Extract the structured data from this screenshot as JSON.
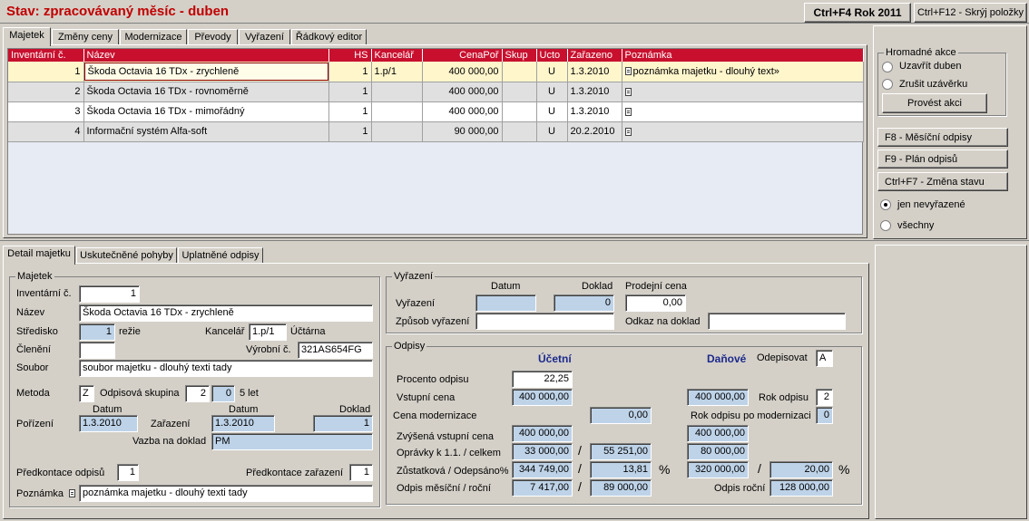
{
  "header": {
    "title": "Stav: zpracovávaný měsíc - duben",
    "btn_year": "Ctrl+F4 Rok 2011",
    "btn_hide": "Ctrl+F12 - Skrýj položky"
  },
  "top_tabs": [
    "Majetek",
    "Změny ceny",
    "Modernizace",
    "Převody",
    "Vyřazení",
    "Řádkový editor"
  ],
  "columns": [
    "Inventární č.",
    "Název",
    "HS",
    "Kancelář",
    "CenaPoř",
    "Skup",
    "Ucto",
    "Zařazeno",
    "Poznámka"
  ],
  "rows": [
    {
      "inv": "1",
      "name": "Škoda Octavia 16 TDx - zrychleně",
      "hs": "1",
      "office": "1.p/1",
      "price": "400 000,00",
      "group": "",
      "ucto": "U",
      "date": "1.3.2010",
      "note": "poznámka majetku - dlouhý text»"
    },
    {
      "inv": "2",
      "name": "Škoda Octavia 16 TDx - rovnoměrně",
      "hs": "1",
      "office": "",
      "price": "400 000,00",
      "group": "",
      "ucto": "U",
      "date": "1.3.2010",
      "note": ""
    },
    {
      "inv": "3",
      "name": "Škoda Octavia 16 TDx - mimořádný",
      "hs": "1",
      "office": "",
      "price": "400 000,00",
      "group": "",
      "ucto": "U",
      "date": "1.3.2010",
      "note": ""
    },
    {
      "inv": "4",
      "name": "Informační systém Alfa-soft",
      "hs": "1",
      "office": "",
      "price": "90 000,00",
      "group": "",
      "ucto": "U",
      "date": "20.2.2010",
      "note": ""
    }
  ],
  "side": {
    "group_title": "Hromadné akce",
    "radio1": "Uzavřít duben",
    "radio2": "Zrušit uzávěrku",
    "action": "Provést akci",
    "f8": "F8 - Měsíční odpisy",
    "f9": "F9 - Plán odpisů",
    "cf7": "Ctrl+F7 - Změna stavu",
    "filter1": "jen nevyřazené",
    "filter2": "všechny"
  },
  "bottom_tabs": [
    "Detail majetku",
    "Uskutečněné pohyby",
    "Uplatněné odpisy"
  ],
  "detail": {
    "group": "Majetek",
    "inv_label": "Inventární č.",
    "inv": "1",
    "name_label": "Název",
    "name": "Škoda Octavia 16 TDx - zrychleně",
    "center_label": "Středisko",
    "center": "1",
    "center_name": "režie",
    "office_label": "Kancelář",
    "office": "1.p/1",
    "office_name": "Účtárna",
    "split_label": "Členění",
    "split": "",
    "serial_label": "Výrobní č.",
    "serial": "321AS654FG",
    "file_label": "Soubor",
    "file": "soubor majetku - dlouhý texti tady",
    "method_label": "Metoda",
    "method": "Z",
    "dep_group_label": "Odpisová skupina",
    "dep_group": "2",
    "dep_sub": "0",
    "years": "5 let",
    "date_hdr": "Datum",
    "date_hdr2": "Datum",
    "doc_hdr": "Doklad",
    "acq_label": "Pořízení",
    "acq_date": "1.3.2010",
    "incl_label": "Zařazení",
    "incl_date": "1.3.2010",
    "doc": "1",
    "link_label": "Vazba na doklad",
    "link": "PM",
    "pre_dep_label": "Předkontace odpisů",
    "pre_dep": "1",
    "pre_incl_label": "Předkontace zařazení",
    "pre_incl": "1",
    "note_label": "Poznámka",
    "note": "poznámka majetku - dlouhý texti tady"
  },
  "disposal": {
    "group": "Vyřazení",
    "date_hdr": "Datum",
    "doc_hdr": "Doklad",
    "price_hdr": "Prodejní cena",
    "label": "Vyřazení",
    "date": "",
    "doc": "0",
    "price": "0,00",
    "method_label": "Způsob vyřazení",
    "method": "",
    "ref_label": "Odkaz na doklad",
    "ref": ""
  },
  "dep": {
    "group": "Odpisy",
    "acc_hdr": "Účetní",
    "tax_hdr": "Daňové",
    "write_label": "Odepisovat",
    "write": "A",
    "pct_label": "Procento odpisu",
    "pct": "22,25",
    "entry_label": "Vstupní cena",
    "entry": "400 000,00",
    "entry_tax": "400 000,00",
    "year_label": "Rok odpisu",
    "year": "2",
    "mod_label": "Cena modernizace",
    "mod": "0,00",
    "year_mod_label": "Rok odpisu po modernizaci",
    "year_mod": "0",
    "inc_label": "Zvýšená vstupní cena",
    "inc": "400 000,00",
    "inc_tax": "400 000,00",
    "corr_label": "Oprávky k 1.1. / celkem",
    "corr1": "33 000,00",
    "corr2": "55 251,00",
    "corr_tax": "80 000,00",
    "rest_label": "Zůstatková / Odepsáno%",
    "rest": "344 749,00",
    "rest_pct": "13,81",
    "rest_tax": "320 000,00",
    "rest_tax_pct": "20,00",
    "month_label": "Odpis měsíční / roční",
    "month": "7 417,00",
    "annual": "89 000,00",
    "annual_tax_label": "Odpis roční",
    "annual_tax": "128 000,00",
    "slash": "/",
    "pct_sign": "%"
  }
}
